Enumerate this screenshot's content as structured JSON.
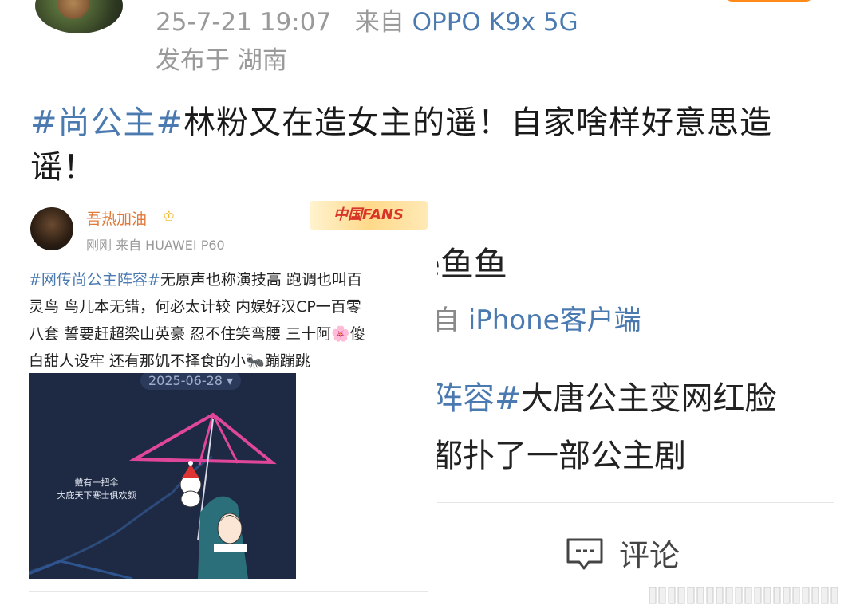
{
  "header": {
    "timestamp": "25-7-21 19:07",
    "source_prefix": "来自",
    "device": "OPPO K9x 5G",
    "location": "发布于 湖南"
  },
  "post": {
    "tag": "#尚公主#",
    "text": "林粉又在造女主的遥！自家啥样好意思造谣！"
  },
  "embedded_card": {
    "username": "吾热加油",
    "badge": "♔",
    "fans_label": "中国FANS",
    "meta": "刚刚  来自 HUAWEI P60",
    "tag": "#网传尚公主阵容#",
    "lines": [
      "无原声也称演技高 跑调也叫百",
      "灵鸟 鸟儿本无错，何必太计较 内娱好汉CP一百零",
      "八套 誓要赶超梁山英豪 忍不住笑弯腰 三十阿🌸傻",
      "白甜人设牢 还有那饥不择食的小🐜蹦蹦跳"
    ],
    "image_date": "2025-06-28 ▾",
    "image_caption_1": "戴有一把伞",
    "image_caption_2": "大庇天下寒士俱欢颜"
  },
  "right_panel": {
    "username": "e鱼鱼",
    "source_prefix": "自",
    "source": "iPhone客户端",
    "tag": "阵容#",
    "text_1": "大唐公主变网红脸",
    "text_2": "都扑了一部公主剧",
    "comment_label": "评论"
  },
  "colors": {
    "link": "#4a7ab0",
    "meta_gray": "#9a9a9a",
    "username_orange": "#e07a3a",
    "follow_orange": "#ff8a1a"
  }
}
